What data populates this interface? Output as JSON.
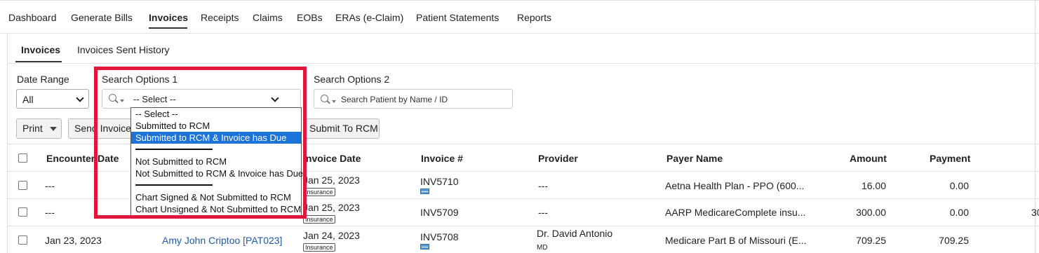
{
  "top_nav": {
    "items": [
      {
        "label": "Dashboard"
      },
      {
        "label": "Generate Bills"
      },
      {
        "label": "Invoices"
      },
      {
        "label": "Receipts"
      },
      {
        "label": "Claims"
      },
      {
        "label": "EOBs"
      },
      {
        "label": "ERAs (e-Claim)"
      },
      {
        "label": "Patient Statements"
      },
      {
        "label": "Reports"
      }
    ],
    "active": "Invoices"
  },
  "sub_tabs": {
    "items": [
      {
        "label": "Invoices"
      },
      {
        "label": "Invoices Sent History"
      }
    ],
    "active": "Invoices"
  },
  "filters": {
    "date_range": {
      "label": "Date Range",
      "value": "All"
    },
    "search_options_1": {
      "label": "Search Options 1",
      "value": "-- Select --"
    },
    "search_options_2": {
      "label": "Search Options 2",
      "placeholder": "Search Patient by Name / ID"
    }
  },
  "dropdown": {
    "items": [
      {
        "label": "-- Select --"
      },
      {
        "label": "Submitted to RCM"
      },
      {
        "label": "Submitted to RCM & Invoice has Due",
        "selected": true
      },
      {
        "label": "Not Submitted to RCM"
      },
      {
        "label": "Not Submitted to RCM & Invoice has Due"
      },
      {
        "label": "Chart Signed & Not Submitted to RCM"
      },
      {
        "label": "Chart Unsigned & Not Submitted to RCM"
      }
    ]
  },
  "toolbar": {
    "print_label": "Print",
    "send_invoice_label": "Send Invoice",
    "submit_rcm_label": "Submit To RCM"
  },
  "table": {
    "columns": [
      "Encounter Date",
      "Invoice Date",
      "Invoice #",
      "Provider",
      "Payer Name",
      "Amount",
      "Payment"
    ],
    "rows": [
      {
        "encounter_date": "---",
        "patient": "",
        "invoice_date": "Jan 25, 2023",
        "badge": "Insurance",
        "invoice_no": "INV5710",
        "provider": "---",
        "provider_suffix": "",
        "payer": "Aetna Health Plan - PPO (600...",
        "amount": "16.00",
        "payment": "0.00",
        "extra": ""
      },
      {
        "encounter_date": "---",
        "patient": "",
        "invoice_date": "Jan 25, 2023",
        "badge": "Insurance",
        "invoice_no": "INV5709",
        "provider": "---",
        "provider_suffix": "",
        "payer": "AARP MedicareComplete insu...",
        "amount": "300.00",
        "payment": "0.00",
        "extra": "30"
      },
      {
        "encounter_date": "Jan 23, 2023",
        "patient": "Amy John Criptoo [PAT023]",
        "invoice_date": "Jan 24, 2023",
        "badge": "Insurance",
        "invoice_no": "INV5708",
        "provider": "Dr. David Antonio",
        "provider_suffix": "MD",
        "payer": "Medicare Part B of Missouri (E...",
        "amount": "709.25",
        "payment": "709.25",
        "extra": ""
      }
    ]
  },
  "colors": {
    "highlight": "#e0163d",
    "selected_option": "#1e73d8",
    "link": "#1f5aa6"
  }
}
